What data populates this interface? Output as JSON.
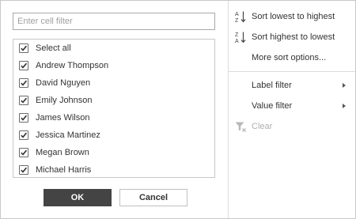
{
  "filter": {
    "search_placeholder": "Enter cell filter",
    "select_all": "Select all",
    "items": [
      {
        "label": "Andrew Thompson",
        "checked": true
      },
      {
        "label": "David Nguyen",
        "checked": true
      },
      {
        "label": "Emily Johnson",
        "checked": true
      },
      {
        "label": "James Wilson",
        "checked": true
      },
      {
        "label": "Jessica Martinez",
        "checked": true
      },
      {
        "label": "Megan Brown",
        "checked": true
      },
      {
        "label": "Michael Harris",
        "checked": true
      }
    ],
    "ok_label": "OK",
    "cancel_label": "Cancel"
  },
  "menu": {
    "sort_asc": "Sort lowest to highest",
    "sort_desc": "Sort highest to lowest",
    "more_sort": "More sort options...",
    "label_filter": "Label filter",
    "value_filter": "Value filter",
    "clear": "Clear",
    "sort_asc_icon_text": {
      "top": "A",
      "bottom": "Z"
    },
    "sort_desc_icon_text": {
      "top": "Z",
      "bottom": "A"
    }
  },
  "colors": {
    "ok_bg": "#444444",
    "disabled_text": "#b0b0b0",
    "border": "#c8c8c8"
  }
}
